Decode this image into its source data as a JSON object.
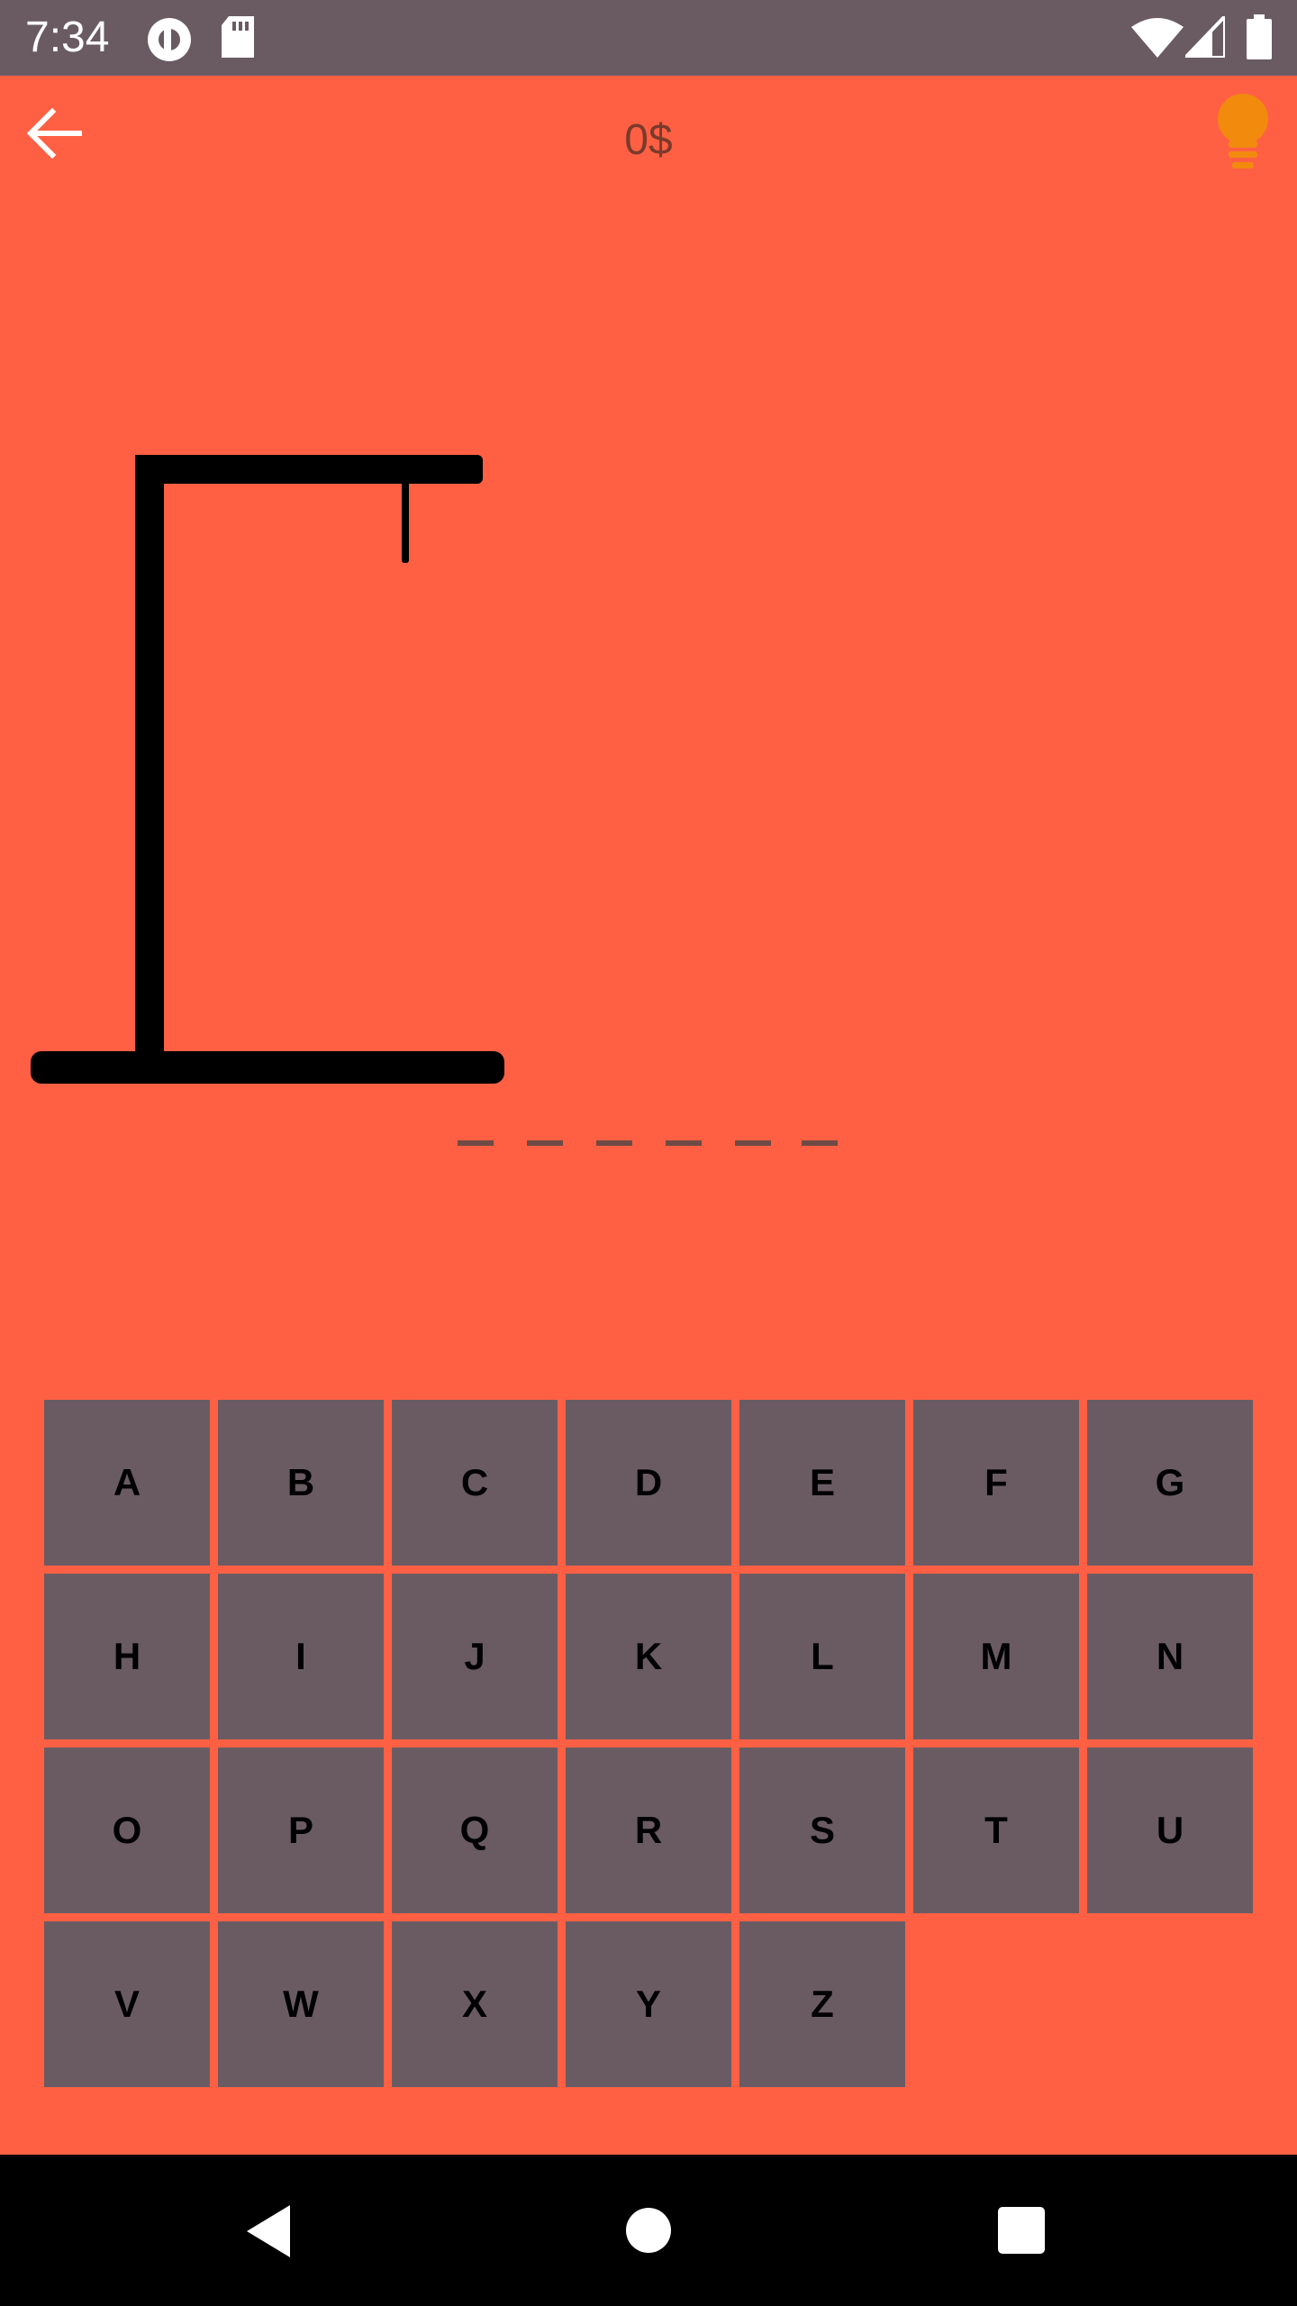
{
  "status_bar": {
    "time": "7:34",
    "icons": [
      "pocket-casts-icon",
      "sd-card-icon",
      "wifi-icon",
      "cell-signal-icon",
      "battery-icon"
    ]
  },
  "app_bar": {
    "back_icon": "arrow-left-icon",
    "balance": "0$",
    "hint_icon": "lightbulb-icon"
  },
  "word": {
    "slot_count": 6,
    "letters": [
      "",
      "",
      "",
      "",
      "",
      ""
    ]
  },
  "keyboard": {
    "keys": [
      "A",
      "B",
      "C",
      "D",
      "E",
      "F",
      "G",
      "H",
      "I",
      "J",
      "K",
      "L",
      "M",
      "N",
      "O",
      "P",
      "Q",
      "R",
      "S",
      "T",
      "U",
      "V",
      "W",
      "X",
      "Y",
      "Z"
    ]
  },
  "nav_bar": {
    "icons": [
      "back-triangle-icon",
      "home-circle-icon",
      "recents-square-icon"
    ]
  },
  "colors": {
    "background": "#FF6043",
    "status_bar": "#6A5B63",
    "key_background": "#6A5B63",
    "hint_icon": "#F28A0E",
    "gallows": "#000000"
  }
}
